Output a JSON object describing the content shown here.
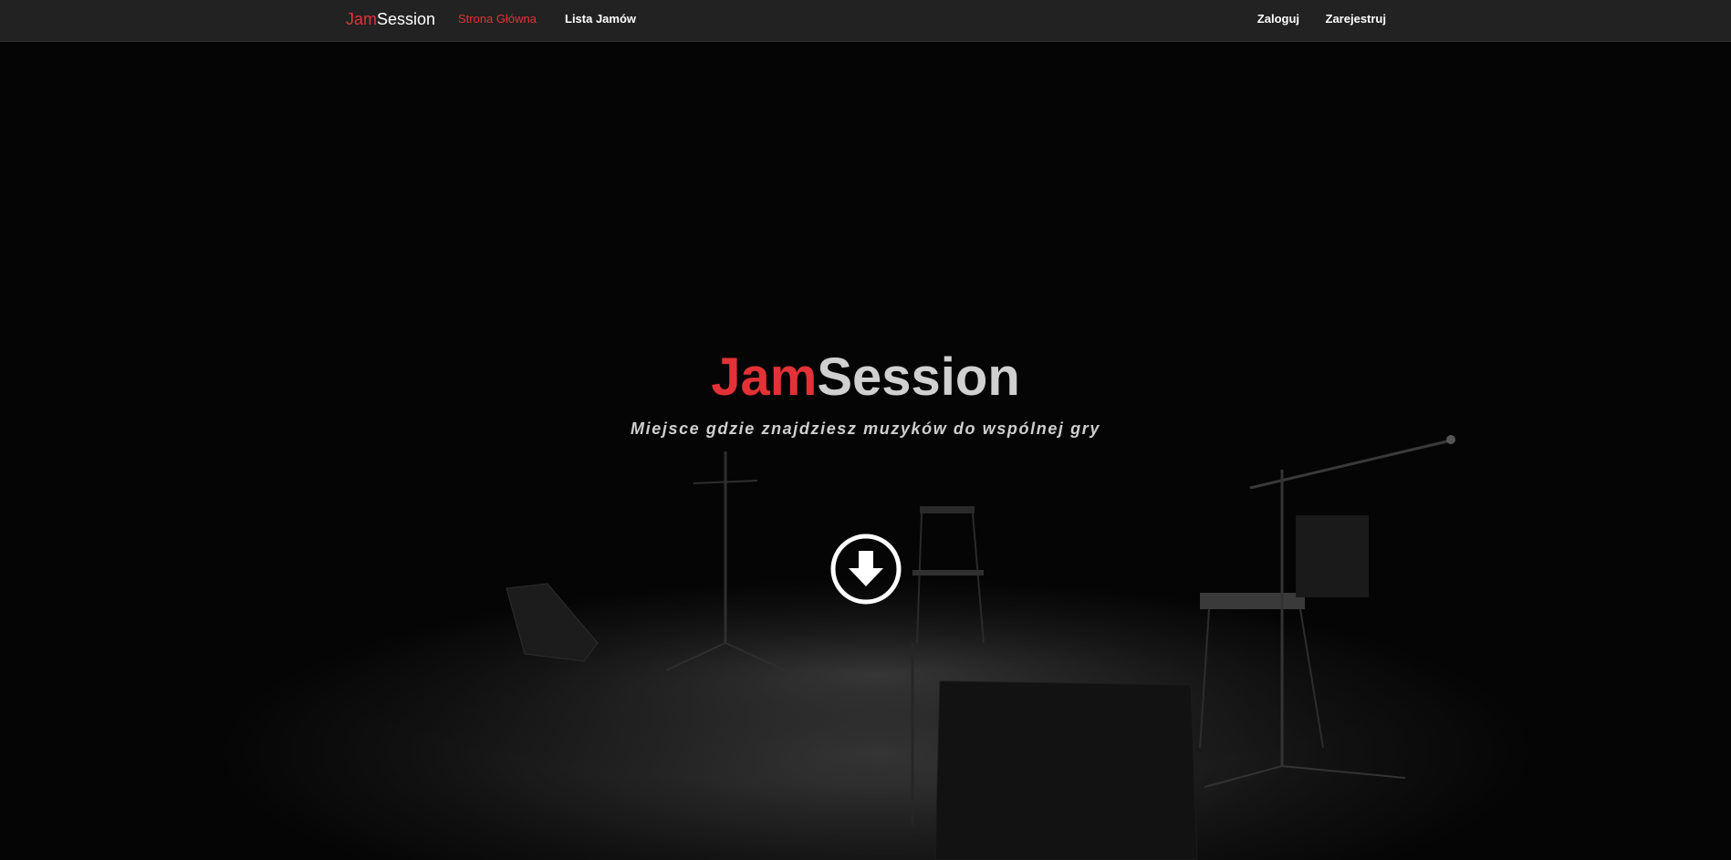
{
  "navbar": {
    "brand_part1": "Jam",
    "brand_part2": "Session",
    "links": {
      "home": "Strona Główna",
      "jams": "Lista Jamów",
      "login": "Zaloguj",
      "register": "Zarejestruj"
    }
  },
  "hero": {
    "title_part1": "Jam",
    "title_part2": "Session",
    "subtitle": "Miejsce gdzie znajdziesz muzyków do wspólnej gry",
    "scroll_icon": "arrow-circle-down-icon"
  },
  "colors": {
    "accent": "#e33237",
    "navbar_bg": "#222222",
    "hero_bg": "#000000"
  }
}
